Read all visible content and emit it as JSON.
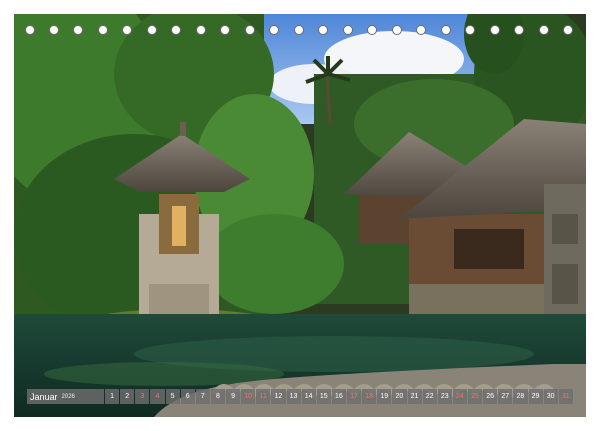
{
  "calendar": {
    "month": "Januar",
    "year": "2026",
    "days": [
      "1",
      "2",
      "3",
      "4",
      "5",
      "6",
      "7",
      "8",
      "9",
      "10",
      "11",
      "12",
      "13",
      "14",
      "15",
      "16",
      "17",
      "18",
      "19",
      "20",
      "21",
      "22",
      "23",
      "24",
      "25",
      "26",
      "27",
      "28",
      "29",
      "30",
      "31"
    ],
    "weekend_days": [
      "3",
      "4",
      "10",
      "11",
      "17",
      "18",
      "24",
      "25",
      "31"
    ]
  },
  "photo": {
    "subject": "temple-shrine-pond-jungle"
  },
  "colors": {
    "page": "#ffffff",
    "calendar_bar": "#6e6e6e",
    "weekend_text": "#ff6a6a"
  }
}
